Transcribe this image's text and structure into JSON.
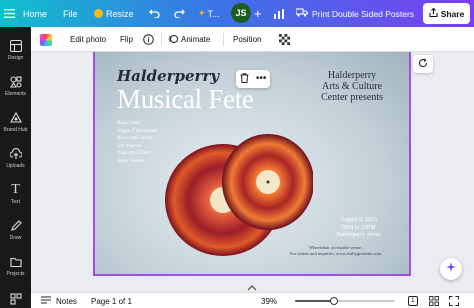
{
  "topbar": {
    "home_label": "Home",
    "file_label": "File",
    "resize_label": "Resize",
    "title_truncated": "T...",
    "avatar_initials": "JS",
    "print_label": "Print Double Sided Posters",
    "share_label": "Share"
  },
  "sidebar": {
    "items": [
      {
        "label": "Design",
        "icon": "layout-icon"
      },
      {
        "label": "Elements",
        "icon": "shapes-icon"
      },
      {
        "label": "Brand Hub",
        "icon": "brand-icon"
      },
      {
        "label": "Uploads",
        "icon": "upload-icon"
      },
      {
        "label": "Text",
        "icon": "text-icon"
      },
      {
        "label": "Draw",
        "icon": "draw-icon"
      },
      {
        "label": "Projects",
        "icon": "folder-icon"
      }
    ]
  },
  "toolbar": {
    "edit_photo": "Edit photo",
    "flip": "Flip",
    "animate": "Animate",
    "position": "Position"
  },
  "poster": {
    "script_title": "Halderperry",
    "main_title": "Musical Fete",
    "org_lines": [
      "Halderperry",
      "Arts & Culture",
      "Center presents"
    ],
    "performers": [
      "Bola Ortiz",
      "Viggo Christensen",
      "Ryuu and Julian",
      "Sid Marvel",
      "Popcorn Klitter",
      "Josie Sisters"
    ],
    "event_lines": [
      "August 9, 2025",
      "5PM to 10PM",
      "Halderperry Arena"
    ],
    "note_lines": [
      "Wheelchair accessible venue.",
      "For tickets and inquiries: www.reallygreatsite.com"
    ]
  },
  "bottombar": {
    "notes_label": "Notes",
    "page_label": "Page 1 of 1",
    "zoom_label": "39%",
    "zoom_level": 0.39,
    "page_count": "1"
  },
  "colors": {
    "accent_purple": "#a050e8",
    "gradient_start": "#10bfcc",
    "gradient_end": "#7a3ff2",
    "sidebar_bg": "#18191b"
  }
}
